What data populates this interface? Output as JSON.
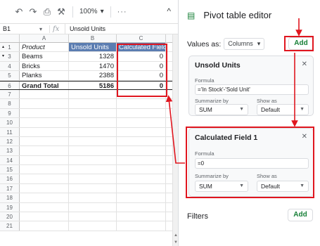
{
  "toolbar": {
    "undo_icon": "undo-icon",
    "redo_icon": "redo-icon",
    "print_icon": "print-icon",
    "paint_format_icon": "paint-format-icon",
    "zoom": "100%",
    "more": "···"
  },
  "formula_bar": {
    "cell_ref": "B1",
    "fx": "fx",
    "value": "Unsold Units"
  },
  "columns": [
    "A",
    "B",
    "C"
  ],
  "rows": [
    {
      "num": "1",
      "a": "Product",
      "b": "Unsold Units",
      "c": "Calculated Field"
    },
    {
      "num": "3",
      "a": "Beams",
      "b": "1328",
      "c": "0"
    },
    {
      "num": "4",
      "a": "Bricks",
      "b": "1470",
      "c": "0"
    },
    {
      "num": "5",
      "a": "Planks",
      "b": "2388",
      "c": "0"
    },
    {
      "num": "6",
      "a": "Grand Total",
      "b": "5186",
      "c": "0"
    },
    {
      "num": "7",
      "a": "",
      "b": "",
      "c": ""
    },
    {
      "num": "8",
      "a": "",
      "b": "",
      "c": ""
    },
    {
      "num": "9",
      "a": "",
      "b": "",
      "c": ""
    },
    {
      "num": "10",
      "a": "",
      "b": "",
      "c": ""
    },
    {
      "num": "11",
      "a": "",
      "b": "",
      "c": ""
    },
    {
      "num": "12",
      "a": "",
      "b": "",
      "c": ""
    },
    {
      "num": "13",
      "a": "",
      "b": "",
      "c": ""
    },
    {
      "num": "14",
      "a": "",
      "b": "",
      "c": ""
    },
    {
      "num": "15",
      "a": "",
      "b": "",
      "c": ""
    },
    {
      "num": "16",
      "a": "",
      "b": "",
      "c": ""
    },
    {
      "num": "17",
      "a": "",
      "b": "",
      "c": ""
    },
    {
      "num": "18",
      "a": "",
      "b": "",
      "c": ""
    },
    {
      "num": "19",
      "a": "",
      "b": "",
      "c": ""
    },
    {
      "num": "20",
      "a": "",
      "b": "",
      "c": ""
    },
    {
      "num": "21",
      "a": "",
      "b": "",
      "c": ""
    }
  ],
  "panel": {
    "title": "Pivot table editor",
    "values_as_label": "Values as:",
    "values_as_value": "Columns",
    "add_label": "Add",
    "card1": {
      "title": "Unsold Units",
      "formula_label": "Formula",
      "formula": "='In Stock'-'Sold Unit'",
      "summarize_label": "Summarize by",
      "summarize_value": "SUM",
      "show_as_label": "Show as",
      "show_as_value": "Default"
    },
    "card2": {
      "title": "Calculated Field 1",
      "formula_label": "Formula",
      "formula": "=0",
      "summarize_label": "Summarize by",
      "summarize_value": "SUM",
      "show_as_label": "Show as",
      "show_as_value": "Default"
    },
    "filters_label": "Filters",
    "filters_add_label": "Add"
  },
  "annotation_color": "#e0161f"
}
